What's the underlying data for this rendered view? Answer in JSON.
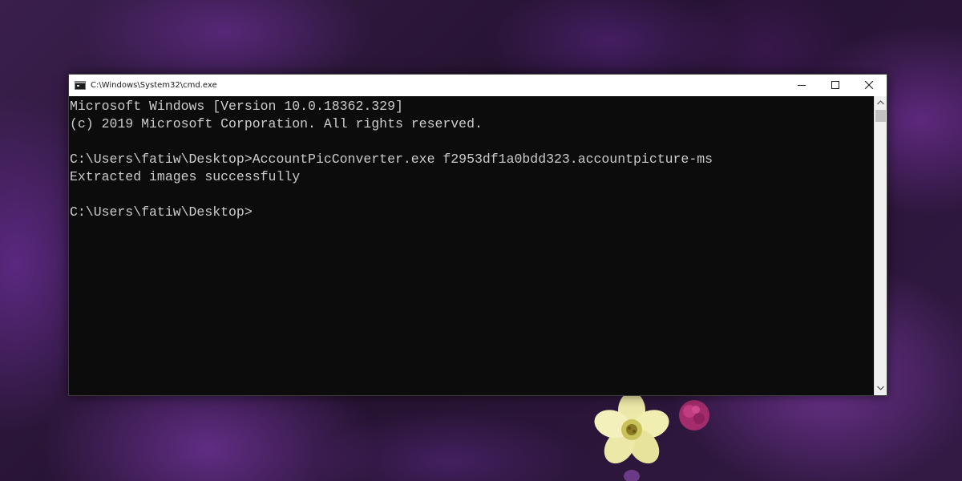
{
  "window": {
    "title": "C:\\Windows\\System32\\cmd.exe",
    "icon": "cmd-icon",
    "controls": {
      "minimize_icon": "minimize-icon",
      "maximize_icon": "maximize-icon",
      "close_icon": "close-icon"
    }
  },
  "console": {
    "background_color": "#0c0c0c",
    "text_color": "#cccccc",
    "lines": [
      "Microsoft Windows [Version 10.0.18362.329]",
      "(c) 2019 Microsoft Corporation. All rights reserved.",
      "",
      "C:\\Users\\fatiw\\Desktop>AccountPicConverter.exe f2953df1a0bdd323.accountpicture-ms",
      "Extracted images successfully",
      "",
      "C:\\Users\\fatiw\\Desktop>"
    ]
  },
  "scrollbar": {
    "up_icon": "chevron-up-icon",
    "down_icon": "chevron-down-icon"
  }
}
